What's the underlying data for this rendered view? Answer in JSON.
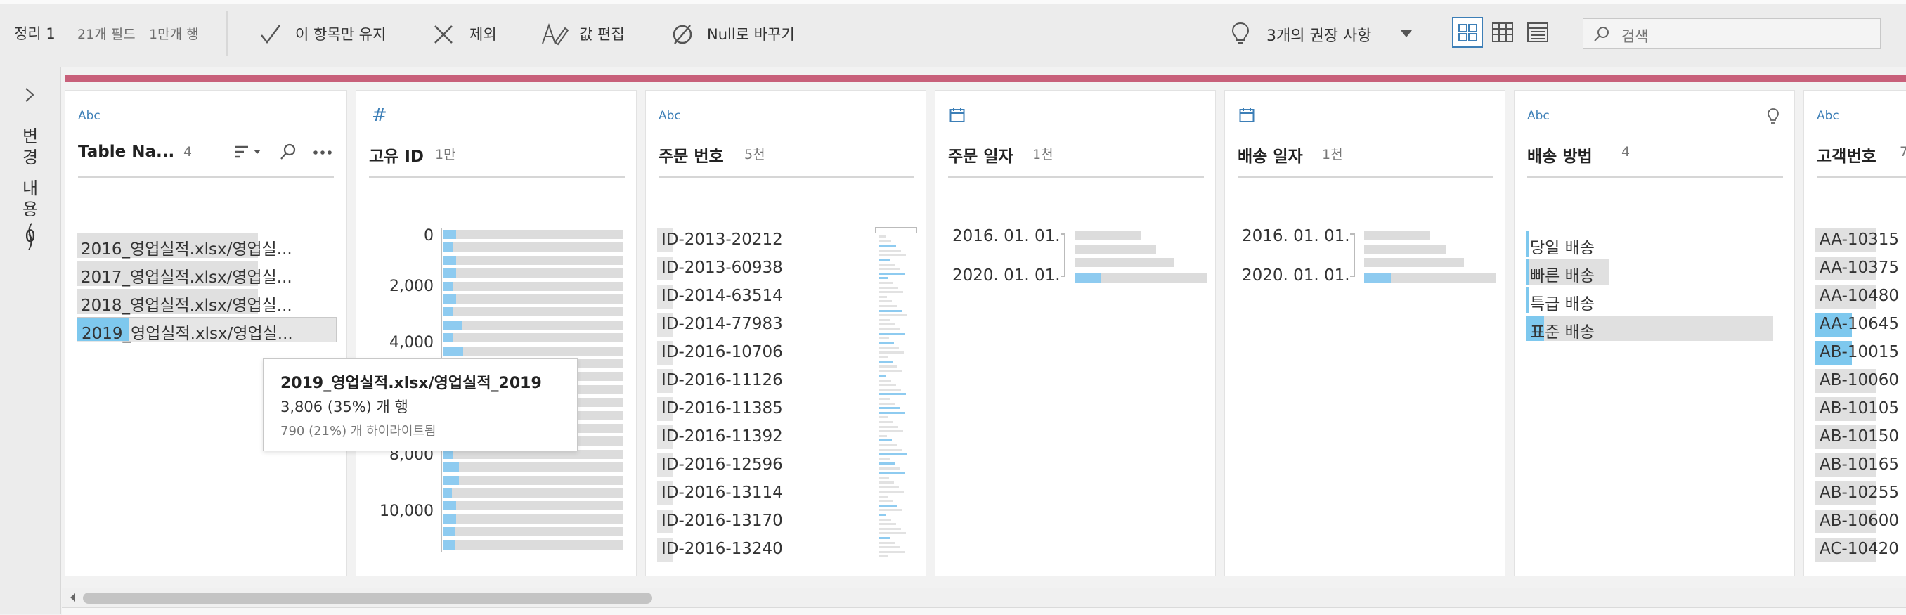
{
  "toolbar": {
    "step_name": "정리 1",
    "field_count": "21개 필드",
    "row_count": "1만개 행",
    "keep_only": "이 항목만 유지",
    "exclude": "제외",
    "edit_values": "값 편집",
    "replace_null": "Null로 바꾸기",
    "recommendations": "3개의 권장 사항",
    "search_placeholder": "검색"
  },
  "left_rail": {
    "label_chars": [
      "변",
      "경",
      "내",
      "용",
      "(",
      "0",
      ")"
    ]
  },
  "cards": [
    {
      "type": "Abc",
      "title": "Table Na...",
      "count": "4",
      "values": [
        "2016_영업실적.xlsx/영업실...",
        "2017_영업실적.xlsx/영업실...",
        "2018_영업실적.xlsx/영업실...",
        "2019_영업실적.xlsx/영업실..."
      ]
    },
    {
      "type": "#",
      "title": "고유 ID",
      "count": "1만",
      "axis_labels": [
        "0",
        "2,000",
        "4,000",
        "6,000",
        "8,000",
        "10,000"
      ]
    },
    {
      "type": "Abc",
      "title": "주문 번호",
      "count": "5천",
      "values": [
        "ID-2013-20212",
        "ID-2013-60938",
        "ID-2014-63514",
        "ID-2014-77983",
        "ID-2016-10706",
        "ID-2016-11126",
        "ID-2016-11385",
        "ID-2016-11392",
        "ID-2016-12596",
        "ID-2016-13114",
        "ID-2016-13170",
        "ID-2016-13240"
      ]
    },
    {
      "type": "date",
      "title": "주문 일자",
      "count": "1천",
      "axis_labels": [
        "2016. 01. 01.",
        "2020. 01. 01."
      ]
    },
    {
      "type": "date",
      "title": "배송 일자",
      "count": "1천",
      "axis_labels": [
        "2016. 01. 01.",
        "2020. 01. 01."
      ]
    },
    {
      "type": "Abc",
      "title": "배송 방법",
      "count": "4",
      "values": [
        "당일 배송",
        "빠른 배송",
        "특급 배송",
        "표준 배송"
      ]
    },
    {
      "type": "Abc",
      "title": "고객번호",
      "count": "7",
      "values": [
        "AA-10315",
        "AA-10375",
        "AA-10480",
        "AA-10645",
        "AB-10015",
        "AB-10060",
        "AB-10105",
        "AB-10150",
        "AB-10165",
        "AB-10255",
        "AB-10600",
        "AC-10420"
      ]
    }
  ],
  "tooltip": {
    "title": "2019_영업실적.xlsx/영업실적_2019",
    "rows": "3,806 (35%) 개 행",
    "highlighted": "790 (21%) 개 하이라이트됨"
  },
  "colors": {
    "accent_red": "#c8607a",
    "highlight_blue": "#7ec8ee",
    "type_icon": "#3d7fb7"
  }
}
